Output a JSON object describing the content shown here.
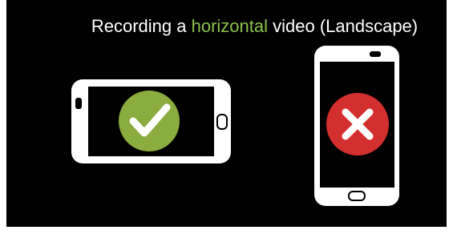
{
  "title": {
    "before": "Recording a ",
    "highlight": "horizontal",
    "after": " video (Landscape)"
  },
  "colors": {
    "background": "#000000",
    "phone_body": "#ffffff",
    "title_text": "#ffffff",
    "highlight_text": "#8bc34a",
    "correct_badge": "#8bac3f",
    "incorrect_badge": "#d32f2f"
  },
  "icons": {
    "landscape_phone": "phone-landscape-icon",
    "portrait_phone": "phone-portrait-icon",
    "correct": "checkmark-icon",
    "incorrect": "cross-icon"
  }
}
